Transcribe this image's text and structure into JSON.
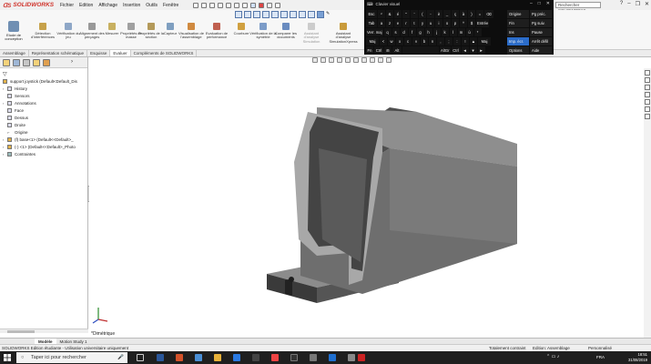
{
  "app": {
    "logo": "SOLIDWORKS",
    "search_placeholder": "Rechercher SOLIDWORKS",
    "help": "?"
  },
  "menu": [
    "Fichier",
    "Edition",
    "Affichage",
    "Insertion",
    "Outils",
    "Fenêtre"
  ],
  "ribbon": {
    "etude_label": "Etude de conception",
    "buttons": [
      "Détection d'interférences",
      "Vérification du jeu",
      "Alignement des perçages",
      "Mesurer",
      "Propriétés de masse",
      "Propriétés de la section",
      "Capteur",
      "Visualisation de l'assemblage",
      "Evaluation de performance",
      "Courbure",
      "Vérification de la symétrie",
      "Comparer les documents",
      "Assistant d'analyse Simulation",
      "Assistant d'analyse SimulationXpress"
    ]
  },
  "command_tabs": [
    "Assemblage",
    "Représentation schématique",
    "Esquisse",
    "Evaluer",
    "Compléments de SOLIDWORKS"
  ],
  "command_tabs_active": "Evaluer",
  "tree": {
    "root": "support joystick (Default<Default_Dis",
    "items": [
      {
        "label": "History",
        "arrow": "›"
      },
      {
        "label": "Sensors",
        "arrow": ""
      },
      {
        "label": "Annotations",
        "arrow": "›"
      },
      {
        "label": "Face",
        "arrow": ""
      },
      {
        "label": "Dessus",
        "arrow": ""
      },
      {
        "label": "Droite",
        "arrow": ""
      },
      {
        "label": "Origine",
        "arrow": ""
      },
      {
        "label": "(f) base<1> (Default<<Default>_",
        "arrow": "›"
      },
      {
        "label": "(-) <1> (Default<<Default>_Photo",
        "arrow": "›"
      },
      {
        "label": "Contraintes",
        "arrow": "›"
      }
    ]
  },
  "viewport": {
    "view_name": "*Dimétrique"
  },
  "bottom_tabs": [
    "Modèle",
    "Motion Study 1"
  ],
  "bottom_tabs_active": "Modèle",
  "status": {
    "left": "SOLIDWORKS Edition étudiante - Utilisation universitaire uniquement",
    "state": "Totalement contraint",
    "mode": "Edition: Assemblage",
    "units": "Personnalisé"
  },
  "taskbar": {
    "search_placeholder": "Taper ici pour rechercher",
    "lang": "FRA",
    "time": "18:51",
    "date": "31/08/2019"
  },
  "osk": {
    "title": "Clavier visuel",
    "rows": [
      [
        "Esc",
        "²",
        "&",
        "é",
        "\"",
        "'",
        "(",
        "-",
        "è",
        "_",
        "ç",
        "à",
        ")",
        "=",
        "⌫"
      ],
      [
        "Tab",
        "a",
        "z",
        "e",
        "r",
        "t",
        "y",
        "u",
        "i",
        "o",
        "p",
        "^",
        "$",
        "Entrée"
      ],
      [
        "Verr. maj",
        "q",
        "s",
        "d",
        "f",
        "g",
        "h",
        "j",
        "k",
        "l",
        "m",
        "ù",
        "*"
      ],
      [
        "Maj",
        "<",
        "w",
        "x",
        "c",
        "v",
        "b",
        "n",
        ",",
        ";",
        ":",
        "!",
        "▲",
        "Maj"
      ],
      [
        "Fn",
        "Ctrl",
        "⊞",
        "Alt",
        " ",
        "AltGr",
        "Ctrl",
        "◄",
        "▼",
        "►"
      ]
    ],
    "side": [
      [
        "Origine",
        "Pg préc."
      ],
      [
        "Fin",
        "Pg suiv."
      ],
      [
        "Ins",
        "Pause"
      ],
      [
        "Imp. écr.",
        "Arrêt défil"
      ],
      [
        "Options",
        "Aide"
      ]
    ]
  }
}
